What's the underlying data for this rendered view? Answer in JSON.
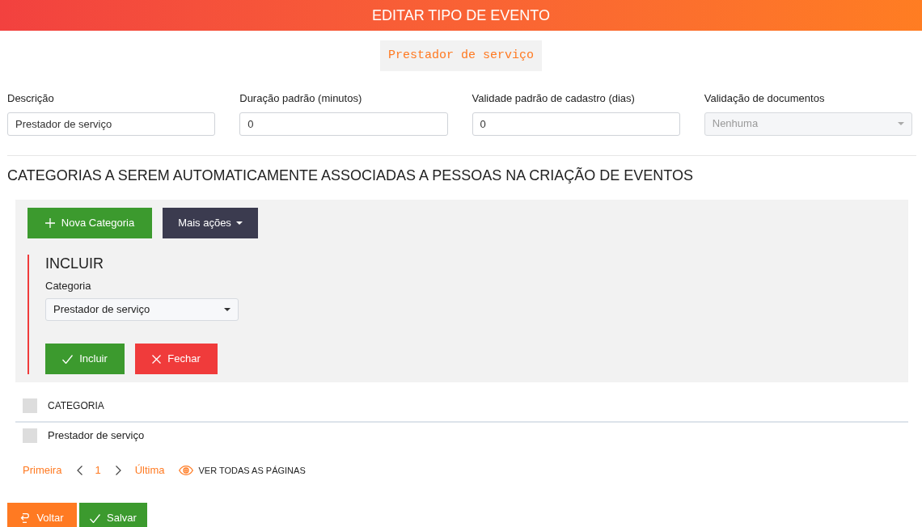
{
  "header": {
    "title": "EDITAR TIPO DE EVENTO"
  },
  "name_badge": "Prestador de serviço",
  "fields": [
    {
      "kind": "text",
      "label": "Descrição",
      "value": "Prestador de serviço",
      "disabled": false
    },
    {
      "kind": "text",
      "label": "Duração padrão (minutos)",
      "value": "0",
      "disabled": false
    },
    {
      "kind": "text",
      "label": "Validade padrão de cadastro (dias)",
      "value": "0",
      "disabled": false
    },
    {
      "kind": "select",
      "label": "Validação de documentos",
      "value": "Nenhuma",
      "disabled": true
    }
  ],
  "section": {
    "title": "CATEGORIAS A SEREM AUTOMATICAMENTE ASSOCIADAS A PESSOAS NA CRIAÇÃO DE EVENTOS",
    "toolbar": [
      {
        "kind": "add",
        "label": "Nova Categoria"
      },
      {
        "kind": "dropdown",
        "label": "Mais ações"
      }
    ],
    "include_form": {
      "title": "INCLUIR",
      "field": {
        "label": "Categoria",
        "value": "Prestador de serviço"
      },
      "buttons": [
        {
          "kind": "confirm",
          "label": "Incluir"
        },
        {
          "kind": "close",
          "label": "Fechar"
        }
      ]
    },
    "table": {
      "columns": [
        "CATEGORIA"
      ],
      "header_checked": false,
      "rows": [
        {
          "cells": [
            "Prestador de serviço"
          ],
          "checked": false
        }
      ]
    },
    "pagination": {
      "first": "Primeira",
      "pages": [
        {
          "label": "1",
          "selected": true
        }
      ],
      "last": "Última",
      "view_all": "VER TODAS AS PÁGINAS"
    }
  },
  "footer_buttons": [
    {
      "kind": "back",
      "label": "Voltar"
    },
    {
      "kind": "save",
      "label": "Salvar"
    }
  ]
}
